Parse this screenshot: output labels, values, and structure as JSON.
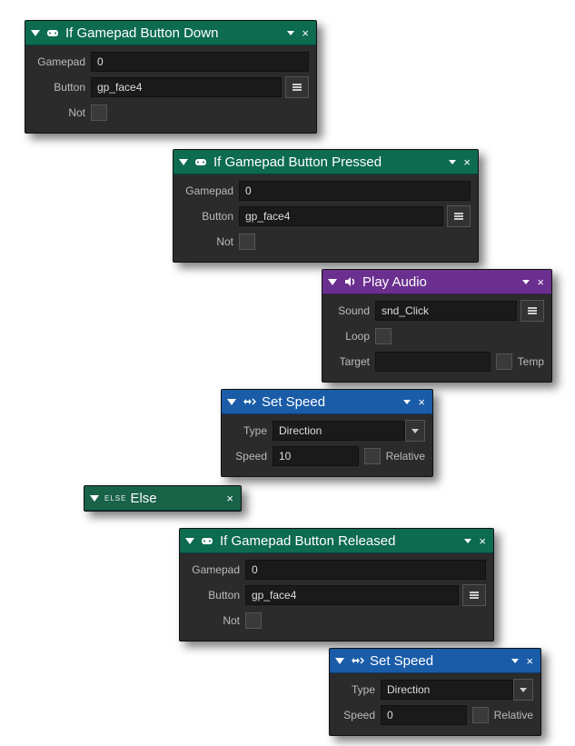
{
  "nodes": {
    "if_down": {
      "title": "If Gamepad Button Down",
      "gamepad_label": "Gamepad",
      "gamepad_value": "0",
      "button_label": "Button",
      "button_value": "gp_face4",
      "not_label": "Not"
    },
    "if_pressed": {
      "title": "If Gamepad Button Pressed",
      "gamepad_label": "Gamepad",
      "gamepad_value": "0",
      "button_label": "Button",
      "button_value": "gp_face4",
      "not_label": "Not"
    },
    "play_audio": {
      "title": "Play Audio",
      "sound_label": "Sound",
      "sound_value": "snd_Click",
      "loop_label": "Loop",
      "target_label": "Target",
      "target_value": "",
      "temp_label": "Temp"
    },
    "set_speed_1": {
      "title": "Set Speed",
      "type_label": "Type",
      "type_value": "Direction",
      "speed_label": "Speed",
      "speed_value": "10",
      "relative_label": "Relative"
    },
    "else": {
      "tag": "ELSE",
      "title": "Else"
    },
    "if_released": {
      "title": "If Gamepad Button Released",
      "gamepad_label": "Gamepad",
      "gamepad_value": "0",
      "button_label": "Button",
      "button_value": "gp_face4",
      "not_label": "Not"
    },
    "set_speed_2": {
      "title": "Set Speed",
      "type_label": "Type",
      "type_value": "Direction",
      "speed_label": "Speed",
      "speed_value": "0",
      "relative_label": "Relative"
    }
  }
}
